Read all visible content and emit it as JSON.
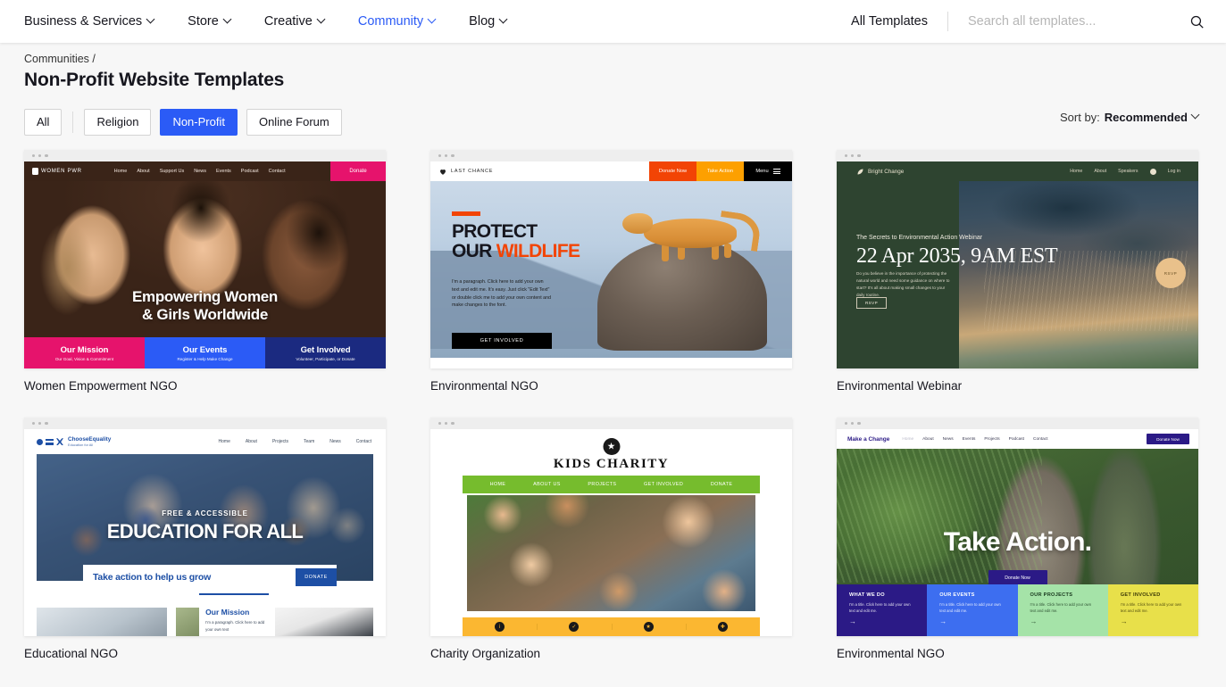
{
  "topnav": {
    "items": [
      {
        "label": "Business & Services",
        "active": false
      },
      {
        "label": "Store",
        "active": false
      },
      {
        "label": "Creative",
        "active": false
      },
      {
        "label": "Community",
        "active": true
      },
      {
        "label": "Blog",
        "active": false
      }
    ],
    "all_templates": "All Templates",
    "search_placeholder": "Search all templates...",
    "search_value": "",
    "icons": {
      "search": "search-icon",
      "chevron": "chevron-down-icon"
    },
    "accent_color": "#2b5bf6"
  },
  "header": {
    "breadcrumb": "Communities /",
    "title": "Non-Profit Website Templates",
    "sort_prefix": "Sort by:",
    "sort_value": "Recommended"
  },
  "filters": {
    "chips": [
      {
        "label": "All",
        "selected": false
      },
      {
        "label": "Religion",
        "selected": false
      },
      {
        "label": "Non-Profit",
        "selected": true
      },
      {
        "label": "Online Forum",
        "selected": false
      }
    ]
  },
  "cards": [
    {
      "label": "Women Empowerment NGO",
      "logo": "WOMEN PWR",
      "nav": [
        "Home",
        "About",
        "Support Us",
        "News",
        "Events",
        "Podcast",
        "Contact"
      ],
      "cta": "Donate",
      "headline_line1": "Empowering Women",
      "headline_line2": "& Girls Worldwide",
      "bars": [
        {
          "title": "Our Mission",
          "sub": "Our Goal, Vision & Commitment",
          "color": "#e6136c"
        },
        {
          "title": "Our Events",
          "sub": "Register & Help Make Change",
          "color": "#2b5bf6"
        },
        {
          "title": "Get Involved",
          "sub": "Volunteer, Participate, or Donate",
          "color": "#1b2a80"
        }
      ]
    },
    {
      "label": "Environmental NGO",
      "logo": "LAST CHANCE",
      "buttons": [
        {
          "label": "Donate Now",
          "color": "#f24405"
        },
        {
          "label": "Take Action",
          "color": "#fda000"
        },
        {
          "label": "Menu",
          "color": "#000000"
        }
      ],
      "headline_line1": "PROTECT",
      "headline_line2a": "OUR ",
      "headline_line2b": "WILDLIFE",
      "paragraph": "I'm a paragraph. Click here to add your own text and edit me. It's easy. Just click \"Edit Text\" or double click me to add your own content and make changes to the font.",
      "cta": "GET INVOLVED"
    },
    {
      "label": "Environmental Webinar",
      "logo": "Bright Change",
      "nav": [
        "Home",
        "About",
        "Speakers",
        "Log in"
      ],
      "subtitle": "The Secrets to Environmental Action Webinar",
      "date": "22 Apr 2035, 9AM EST",
      "paragraph": "Do you believe in the importance of protecting the natural world and need some guidance on where to start? It's all about making small changes to your daily routine.",
      "cta": "RSVP",
      "badge": "RSVP"
    },
    {
      "label": "Educational NGO",
      "logo": "ChooseEquality",
      "logo_sub": "Education for All",
      "nav": [
        "Home",
        "About",
        "Projects",
        "Team",
        "News",
        "Contact"
      ],
      "kicker": "FREE & ACCESSIBLE",
      "headline": "EDUCATION FOR ALL",
      "cta_text": "Take action to help us grow",
      "cta": "DONATE",
      "section_title": "Our Mission",
      "section_body": "I'm a paragraph. Click here to add your own text"
    },
    {
      "label": "Charity Organization",
      "logo": "KIDS CHARITY",
      "nav": [
        "HOME",
        "ABOUT US",
        "PROJECTS",
        "GET INVOLVED",
        "DONATE"
      ],
      "icons": [
        "info-icon",
        "check-icon",
        "star-icon",
        "plus-icon"
      ]
    },
    {
      "label": "Environmental NGO",
      "logo": "Make a Change",
      "nav": [
        "Home",
        "About",
        "News",
        "Events",
        "Projects",
        "Podcast",
        "Contact"
      ],
      "nav_cta": "Donate Now",
      "headline": "Take Action.",
      "cta": "Donate Now",
      "columns": [
        {
          "title": "WHAT WE DO",
          "body": "I'm a title. Click here to add your own text and edit me.",
          "color": "#2b1a86"
        },
        {
          "title": "OUR EVENTS",
          "body": "I'm a title. Click here to add your own text and edit me.",
          "color": "#3d6ef0"
        },
        {
          "title": "OUR PROJECTS",
          "body": "I'm a title. Click here to add your own text and edit me.",
          "color": "#a5e3a8"
        },
        {
          "title": "GET INVOLVED",
          "body": "I'm a title. Click here to add your own text and edit me.",
          "color": "#e8e04a"
        }
      ]
    }
  ]
}
